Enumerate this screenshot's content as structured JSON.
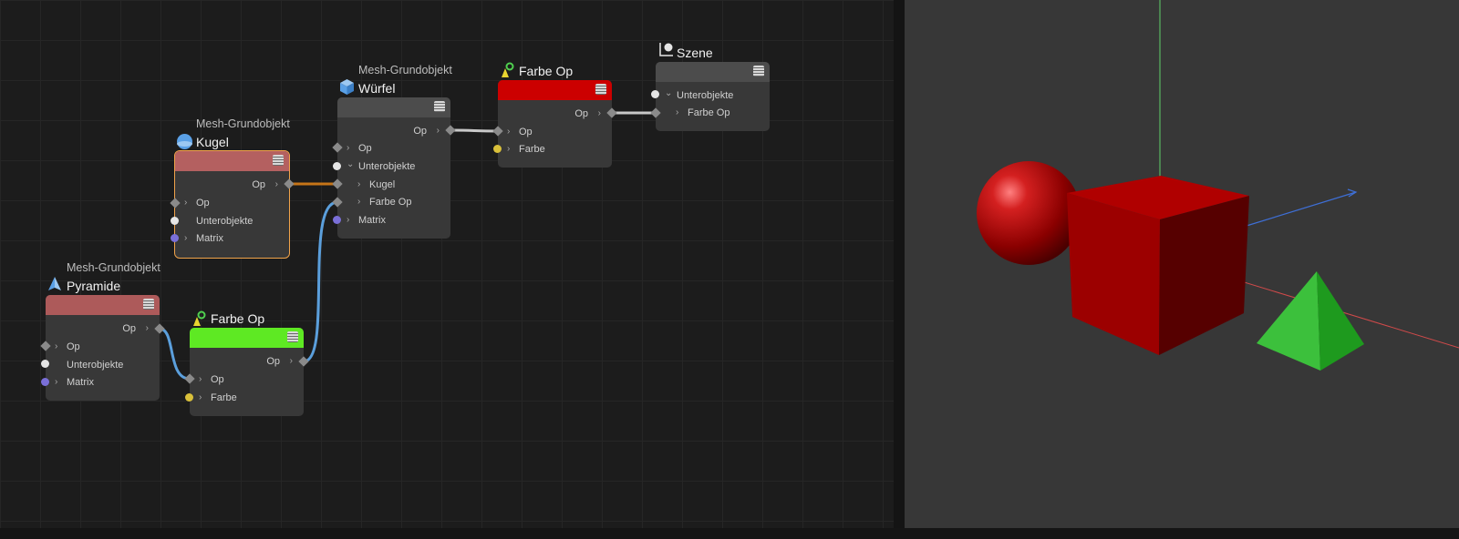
{
  "nodes": {
    "kugel": {
      "subtitle": "Mesh-Grundobjekt",
      "title": "Kugel",
      "out": "Op",
      "in_op": "Op",
      "children": "Unterobjekte",
      "matrix": "Matrix"
    },
    "pyramide": {
      "subtitle": "Mesh-Grundobjekt",
      "title": "Pyramide",
      "out": "Op",
      "in_op": "Op",
      "children": "Unterobjekte",
      "matrix": "Matrix"
    },
    "wuerfel": {
      "subtitle": "Mesh-Grundobjekt",
      "title": "Würfel",
      "out": "Op",
      "in_op": "Op",
      "children": "Unterobjekte",
      "child1": "Kugel",
      "child2": "Farbe Op",
      "matrix": "Matrix"
    },
    "farbe_red": {
      "title": "Farbe Op",
      "out": "Op",
      "in_op": "Op",
      "farbe": "Farbe"
    },
    "farbe_green": {
      "title": "Farbe Op",
      "out": "Op",
      "in_op": "Op",
      "farbe": "Farbe"
    },
    "szene": {
      "title": "Szene",
      "children": "Unterobjekte",
      "child1": "Farbe Op"
    }
  },
  "icons": {
    "sphere": "sphere-icon",
    "cube": "cube-icon",
    "pyramid": "pyramid-icon",
    "color_op": "color-op-icon",
    "scene": "scene-icon",
    "menu": "menu-icon"
  },
  "colors": {
    "header_kugel": "#b46060",
    "header_pyramide": "#ad5a5a",
    "header_wuerfel": "#4c4c4c",
    "header_farbe_red": "#cc0000",
    "header_farbe_green": "#5ee923",
    "header_szene": "#4c4c4c",
    "selection": "#f0a34a",
    "wire_orange": "#c67518",
    "wire_blue": "#5b9fdc",
    "wire_grey": "#c8c8c8",
    "pin_matrix": "#7a6fd8",
    "pin_farbe": "#d9c03a",
    "cube_red": "#b00000",
    "pyramid_green": "#2fb42f"
  }
}
